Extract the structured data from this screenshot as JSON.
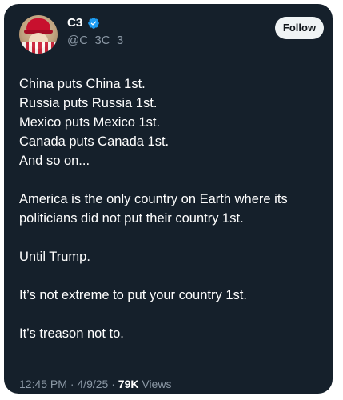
{
  "author": {
    "display_name": "C3",
    "handle": "@C_3C_3",
    "verified": true,
    "verified_color": "#1d9bf0",
    "avatar_icon": "profile-avatar-icon"
  },
  "follow_label": "Follow",
  "tweet": {
    "lines": [
      "China puts China 1st.",
      "Russia puts Russia 1st.",
      "Mexico puts Mexico 1st.",
      "Canada puts Canada 1st.",
      "And so on..."
    ],
    "paragraphs": [
      "America is the only country on Earth where its politicians did not put their country 1st.",
      "Until Trump.",
      "It’s not extreme to put your country 1st.",
      "It’s treason not to."
    ]
  },
  "meta": {
    "time": "12:45 PM",
    "date": "4/9/25",
    "separator": " · ",
    "views_count": "79K",
    "views_label": " Views"
  },
  "colors": {
    "card_background": "#15202b",
    "text_primary": "#ffffff",
    "text_secondary": "#8b98a5",
    "follow_button_bg": "#eff3f4"
  }
}
